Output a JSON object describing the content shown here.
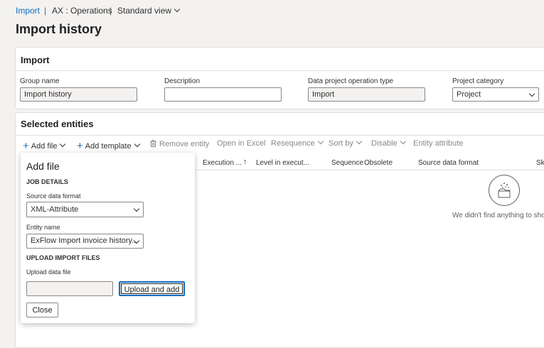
{
  "breadcrumb": {
    "item1": "Import",
    "item2": "AX : Operations",
    "item3": "Standard view"
  },
  "page_title": "Import history",
  "import_section": {
    "title": "Import",
    "fields": {
      "group_name_label": "Group name",
      "group_name_value": "Import history",
      "description_label": "Description",
      "description_value": "",
      "op_type_label": "Data project operation type",
      "op_type_value": "Import",
      "category_label": "Project category",
      "category_value": "Project"
    }
  },
  "entities_section": {
    "title": "Selected entities",
    "toolbar": {
      "add_file": "Add file",
      "add_template": "Add template",
      "remove_entity": "Remove entity",
      "open_in_excel": "Open in Excel",
      "resequence": "Resequence",
      "sort_by": "Sort by",
      "disable": "Disable",
      "entity_attribute": "Entity attribute"
    },
    "columns": {
      "execution": "Execution ...",
      "level": "Level in execut...",
      "sequence": "Sequence",
      "obsolete": "Obsolete",
      "source_format": "Source data format",
      "skip": "Ski"
    },
    "sort_arrow": "↑",
    "empty_message": "We didn't find anything to show"
  },
  "add_file_panel": {
    "title": "Add file",
    "job_details": "JOB DETAILS",
    "source_format_label": "Source data format",
    "source_format_value": "XML-Attribute",
    "entity_name_label": "Entity name",
    "entity_name_value": "ExFlow Import invoice history...",
    "upload_header": "UPLOAD IMPORT FILES",
    "upload_label": "Upload data file",
    "upload_button": "Upload and add",
    "close_button": "Close"
  },
  "colors": {
    "accent": "#0f6cbd",
    "background": "#f3f2f1",
    "disabled_text": "#8a8886"
  }
}
